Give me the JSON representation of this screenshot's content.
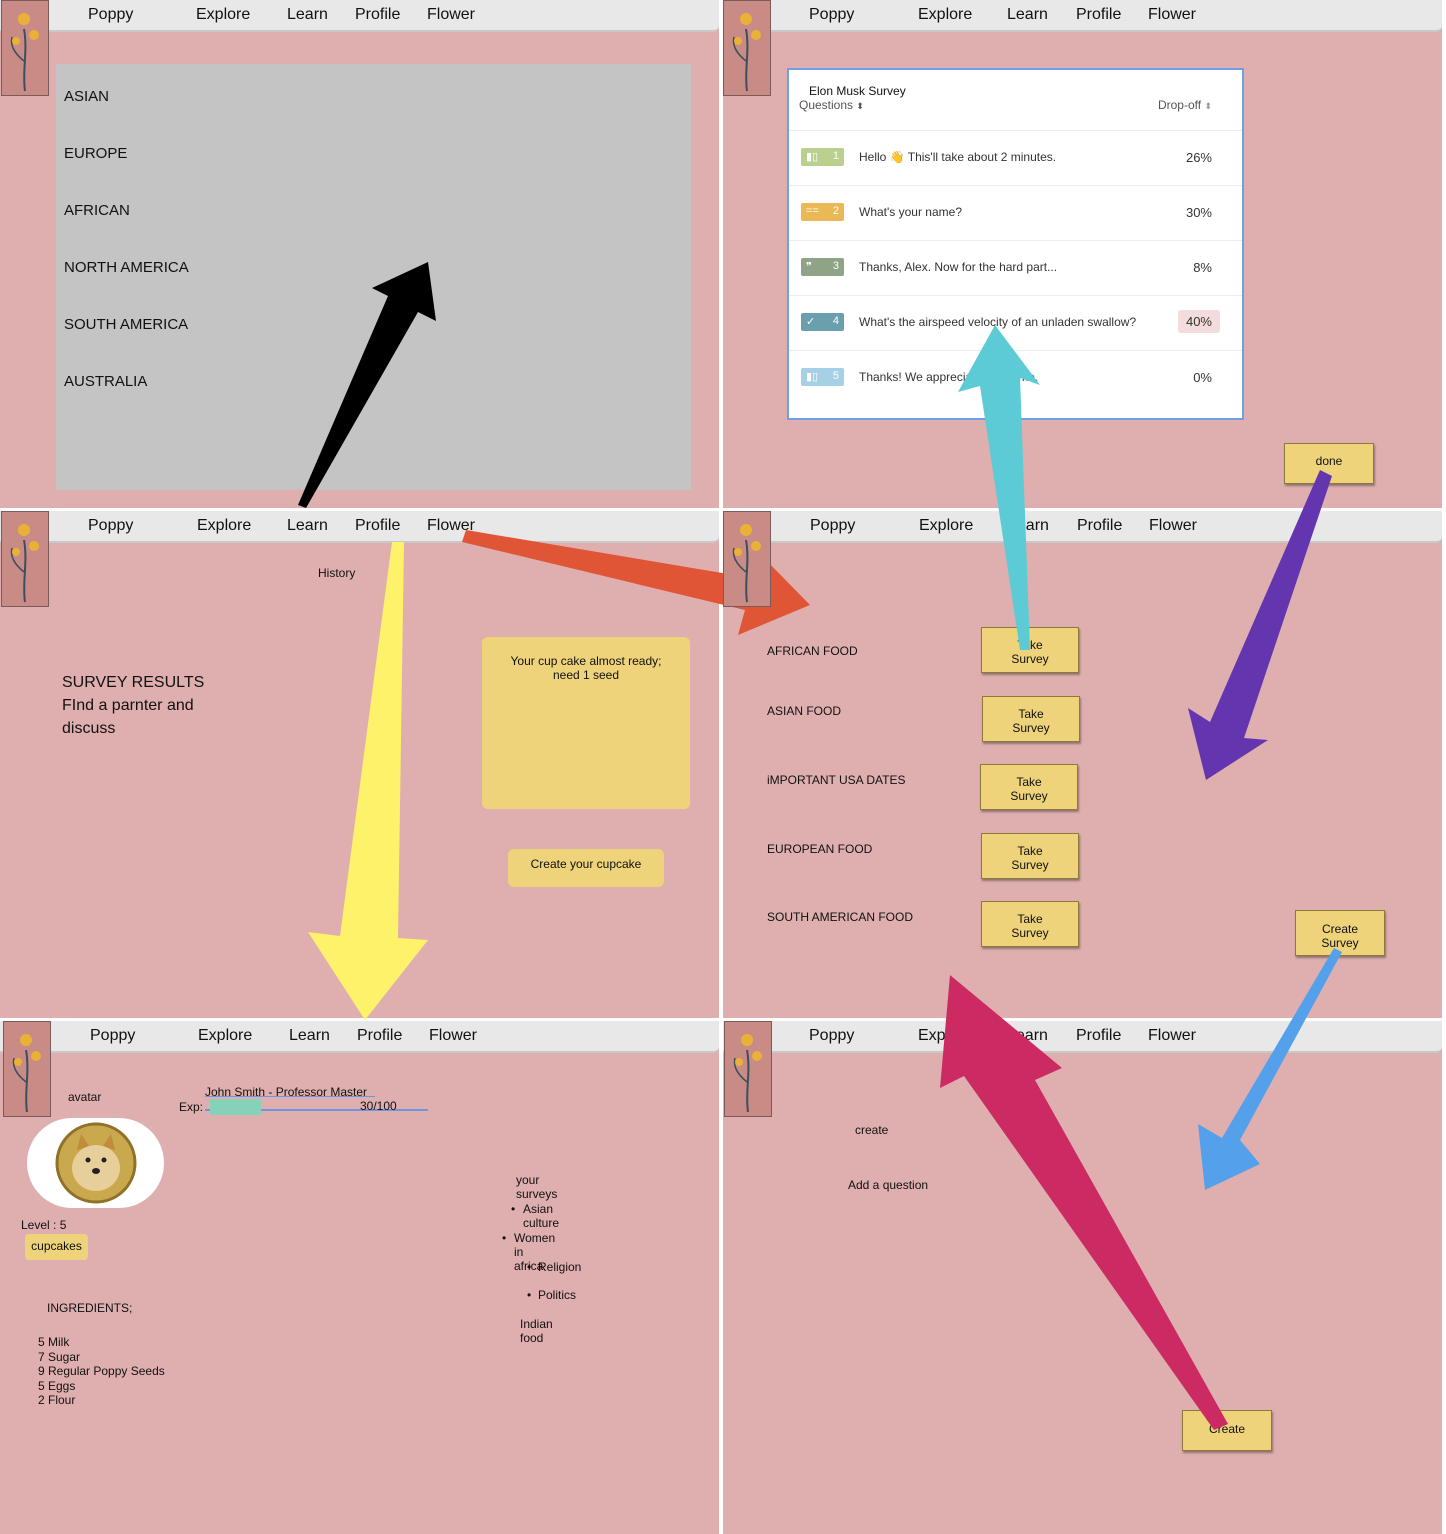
{
  "nav": {
    "brand": "Poppy",
    "explore": "Explore",
    "learn": "Learn",
    "profile": "Profile",
    "flower": "Flower"
  },
  "colors": {
    "panel_bg": "#dfafaf",
    "sticky": "#eed37a",
    "gray_box": "#c4c4c4",
    "arrow_black": "#000000",
    "arrow_red": "#e05535",
    "arrow_yellow": "#fdf26a",
    "arrow_cyan": "#5ccbd6",
    "arrow_purple": "#6336b0",
    "arrow_blue": "#54a0ea",
    "arrow_magenta": "#cc2a63"
  },
  "explore_regions": [
    "ASIAN",
    "EUROPE",
    "AFRICAN",
    "NORTH AMERICA",
    "SOUTH AMERICA",
    "AUSTRALIA"
  ],
  "survey": {
    "title": "Elon Musk Survey",
    "col_questions": "Questions",
    "col_dropoff": "Drop-off",
    "sort_icon": "⬍",
    "rows": [
      {
        "num": "1",
        "text": "Hello 👋 This'll take about 2 minutes.",
        "pct": "26%",
        "color": "#b9d08e",
        "icon": "slider-icon",
        "glyph": "▮▯"
      },
      {
        "num": "2",
        "text": "What's your name?",
        "pct": "30%",
        "color": "#eab955",
        "icon": "short-text-icon",
        "glyph": "=="
      },
      {
        "num": "3",
        "text": "Thanks, Alex. Now for the hard part...",
        "pct": "8%",
        "color": "#8fa386",
        "icon": "quote-icon",
        "glyph": "❞"
      },
      {
        "num": "4",
        "text": "What's the airspeed velocity of an unladen swallow?",
        "pct": "40%",
        "color": "#6a9fae",
        "icon": "check-icon",
        "glyph": "✓"
      },
      {
        "num": "5",
        "text": "Thanks! We appreciate your time.",
        "pct": "0%",
        "color": "#a6d1e4",
        "icon": "end-icon",
        "glyph": "▮▯"
      }
    ],
    "done_label": "done"
  },
  "learn_page": {
    "history_label": "History",
    "results_lines": [
      "SURVEY RESULTS",
      "FInd a parnter and",
      "discuss"
    ],
    "cupcake_status_line1": "Your cup cake almost ready;",
    "cupcake_status_line2": "need  1 seed",
    "create_cupcake": "Create your cupcake"
  },
  "surveys_page": {
    "items": [
      {
        "label": "AFRICAN FOOD",
        "button_line1": "Take",
        "button_line2": "Survey"
      },
      {
        "label": "ASIAN  FOOD",
        "button_line1": "Take",
        "button_line2": "Survey"
      },
      {
        "label": "iMPORTANT USA DATES",
        "button_line1": "Take",
        "button_line2": "Survey"
      },
      {
        "label": "EUROPEAN  FOOD",
        "button_line1": "Take",
        "button_line2": "Survey"
      },
      {
        "label": "SOUTH AMERICAN FOOD",
        "button_line1": "Take",
        "button_line2": "Survey"
      }
    ],
    "create_survey_line1": "Create",
    "create_survey_line2": "Survey"
  },
  "profile_page": {
    "avatar_label": "avatar",
    "user_title": "John Smith  - Professor Master",
    "exp_label": "Exp:",
    "exp_value": "30/100",
    "exp_progress": 0.3,
    "level": "Level : 5",
    "cupcakes_label": "cupcakes",
    "ingredients_title": "INGREDIENTS;",
    "ingredients": [
      "5 Milk",
      "7 Sugar",
      "9 Regular Poppy Seeds",
      "5 Eggs",
      "2 Flour"
    ],
    "surveys_title": "your surveys",
    "surveys": [
      "Asian culture",
      "Women in africa",
      "Religion",
      "Politics"
    ],
    "extra_survey": "Indian food"
  },
  "create_page": {
    "create_label": "create",
    "add_question": "Add a question",
    "create_button": "Create"
  }
}
